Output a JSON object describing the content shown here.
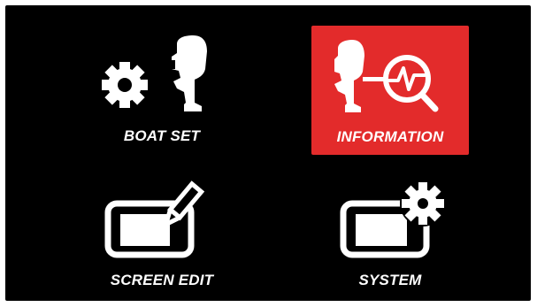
{
  "menu": {
    "tiles": [
      {
        "label": "BOAT SET",
        "icon": "gear-engine-icon",
        "selected": false
      },
      {
        "label": "INFORMATION",
        "icon": "engine-diagnostics-icon",
        "selected": true
      },
      {
        "label": "SCREEN EDIT",
        "icon": "screen-edit-icon",
        "selected": false
      },
      {
        "label": "SYSTEM",
        "icon": "system-settings-icon",
        "selected": false
      }
    ]
  },
  "colors": {
    "background": "#000000",
    "selected": "#e32b2b",
    "foreground": "#ffffff"
  }
}
